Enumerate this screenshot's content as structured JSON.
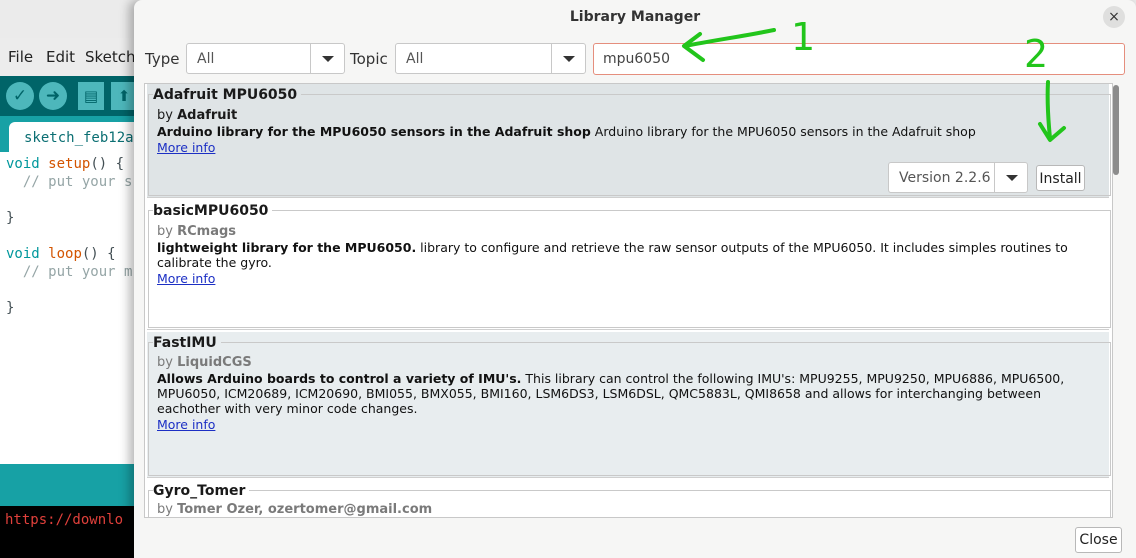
{
  "ide": {
    "menu": [
      "File",
      "Edit",
      "Sketch"
    ],
    "tab_label": "sketch_feb12a",
    "code": [
      {
        "kw": "void",
        "fn": "setup",
        "rest": "() {"
      },
      {
        "comment": "  // put your s"
      },
      {
        "plain": "}"
      },
      {
        "kw": "void",
        "fn": "loop",
        "rest": "() {"
      },
      {
        "comment": "  // put your m"
      },
      {
        "plain": "}"
      }
    ],
    "console_text": "https://downlo"
  },
  "dialog": {
    "title": "Library Manager",
    "close_x": "×",
    "type_label": "Type",
    "type_value": "All",
    "topic_label": "Topic",
    "topic_value": "All",
    "search_value": "mpu6050",
    "close_button": "Close"
  },
  "libraries": [
    {
      "name": "Adafruit MPU6050",
      "by": "by",
      "author": "Adafruit",
      "summary": "Arduino library for the MPU6050 sensors in the Adafruit shop",
      "description": " Arduino library for the MPU6050 sensors in the Adafruit shop",
      "more_info": "More info",
      "version": "Version 2.2.6",
      "install": "Install"
    },
    {
      "name": "basicMPU6050",
      "by": "by",
      "author": "RCmags",
      "summary": "lightweight library for the MPU6050.",
      "description": " library to configure and retrieve the raw sensor outputs of the MPU6050. It includes simples routines to calibrate the gyro.",
      "more_info": "More info"
    },
    {
      "name": "FastIMU",
      "by": "by",
      "author": "LiquidCGS",
      "summary": "Allows Arduino boards to control a variety of IMU's.",
      "description": " This library can control the following IMU's: MPU9255, MPU9250, MPU6886, MPU6500, MPU6050, ICM20689, ICM20690, BMI055, BMX055, BMI160, LSM6DS3, LSM6DSL, QMC5883L, QMI8658 and allows for interchanging between eachother with very minor code changes.",
      "more_info": "More info"
    },
    {
      "name": "Gyro_Tomer",
      "by": "by",
      "author": "Tomer Ozer, ozertomer@gmail.com"
    }
  ],
  "annotations": {
    "step1": "1",
    "step2": "2",
    "color": "#22c51b"
  },
  "colors": {
    "toolbar": "#006468",
    "tabbar": "#17a1a5",
    "selected_row": "#dfe4e6",
    "alt_row": "#e8edef",
    "link": "#1c2fc4",
    "search_border": "#e58e7d"
  }
}
